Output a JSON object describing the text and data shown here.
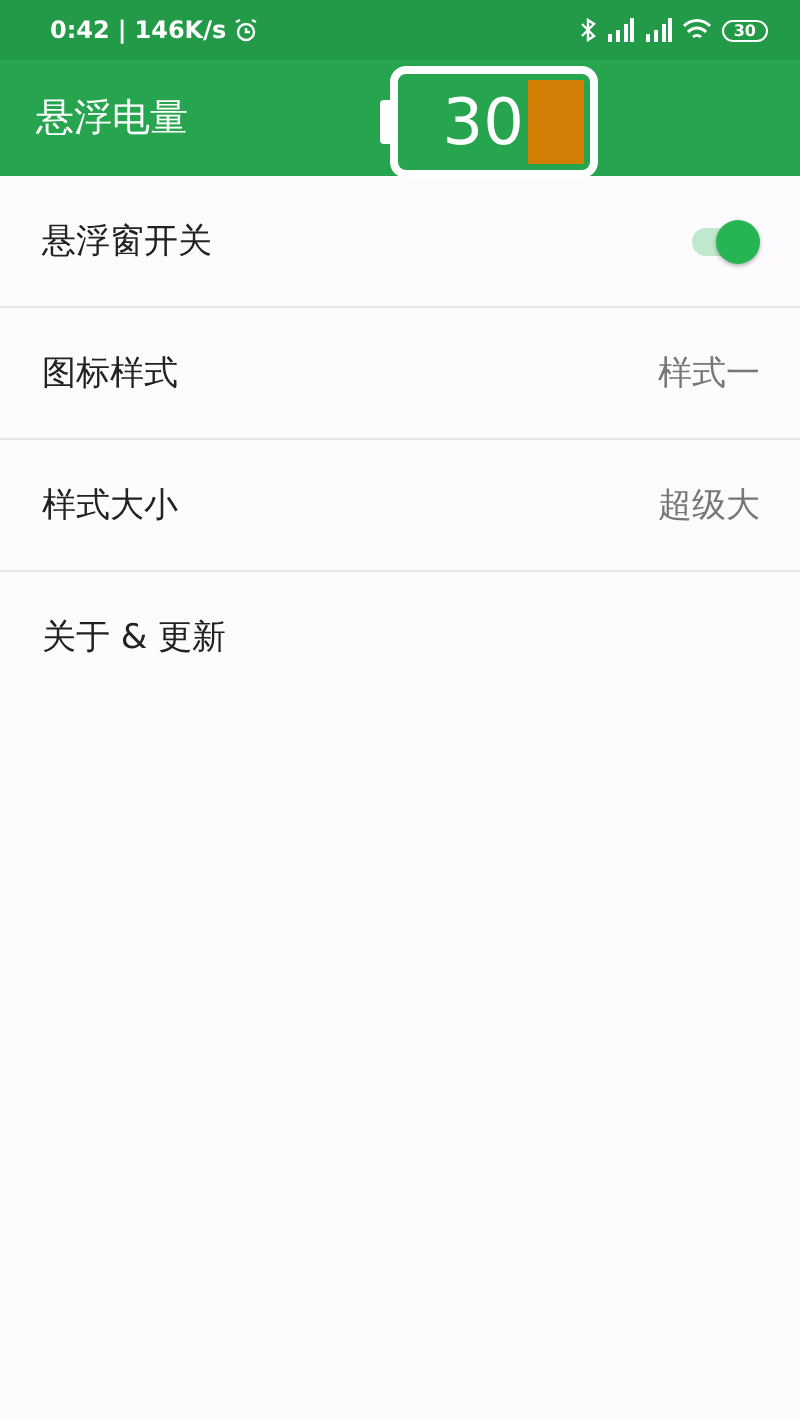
{
  "status_bar": {
    "time": "0:42",
    "separator": "|",
    "speed": "146K/s",
    "battery": "30"
  },
  "app_bar": {
    "title": "悬浮电量"
  },
  "floating_battery": {
    "value": "30"
  },
  "settings": [
    {
      "kind": "switch",
      "label": "悬浮窗开关",
      "on": true
    },
    {
      "kind": "value",
      "label": "图标样式",
      "value": "样式一"
    },
    {
      "kind": "value",
      "label": "样式大小",
      "value": "超级大"
    },
    {
      "kind": "link",
      "label": "关于 & 更新"
    }
  ]
}
